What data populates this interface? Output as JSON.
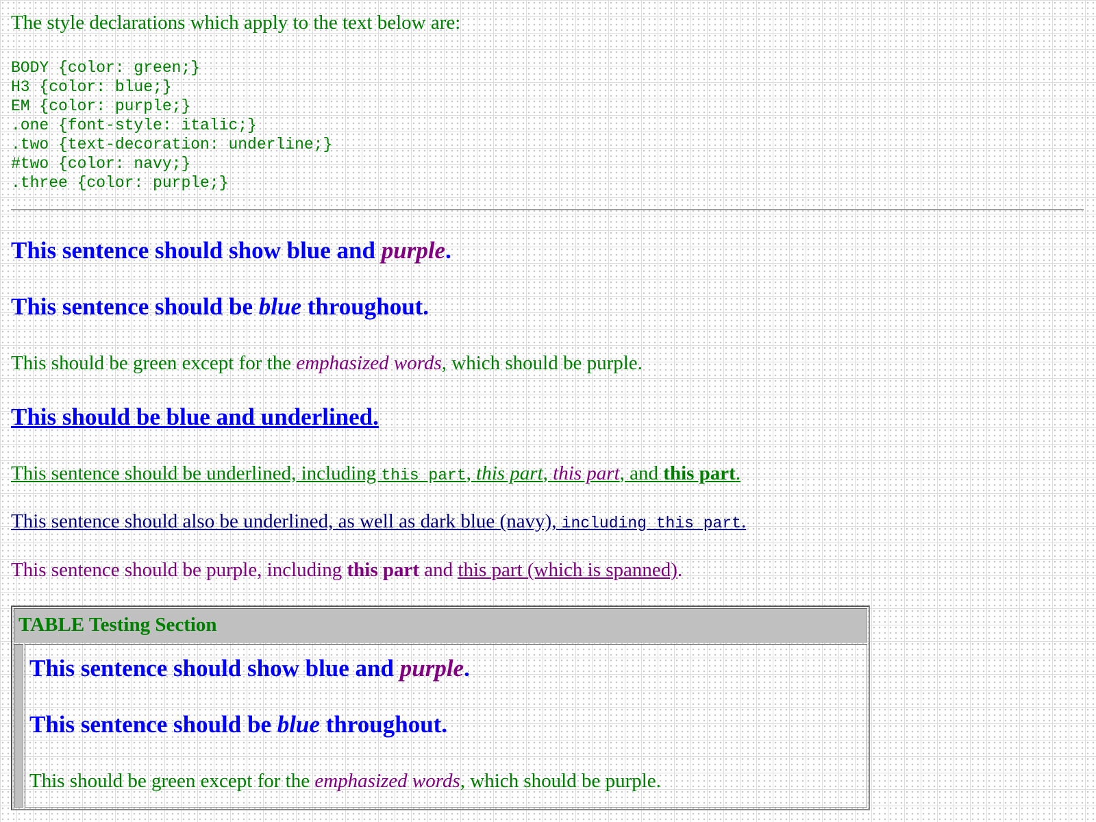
{
  "intro": "The style declarations which apply to the text below are:",
  "style_rules": "BODY {color: green;}\nH3 {color: blue;}\nEM {color: purple;}\n.one {font-style: italic;}\n.two {text-decoration: underline;}\n#two {color: navy;}\n.three {color: purple;}",
  "h3_1": {
    "text": "This sentence should show blue and ",
    "em": "purple",
    "end": "."
  },
  "h3_2": {
    "text": "This sentence should be ",
    "em": "blue",
    "end": " throughout."
  },
  "p_green": {
    "text": "This should be green except for the ",
    "em": "emphasized words",
    "end": ", which should be purple."
  },
  "h3_underlined": "This should be blue and underlined.",
  "p_underline": {
    "a": "This sentence should be underlined, including ",
    "code": "this part",
    "b": ", ",
    "i": "this part",
    "c": ", ",
    "em": "this part",
    "d": ", and ",
    "strong": "this part",
    "e": "."
  },
  "p_navy": {
    "a": "This sentence should also be underlined, as well as dark blue (navy), ",
    "code": "including this part",
    "b": "."
  },
  "p_purple": {
    "a": "This sentence should be purple, including ",
    "strong": "this part",
    "b": " and ",
    "span": "this part (which is spanned)",
    "c": "."
  },
  "table": {
    "caption": "TABLE Testing Section"
  }
}
